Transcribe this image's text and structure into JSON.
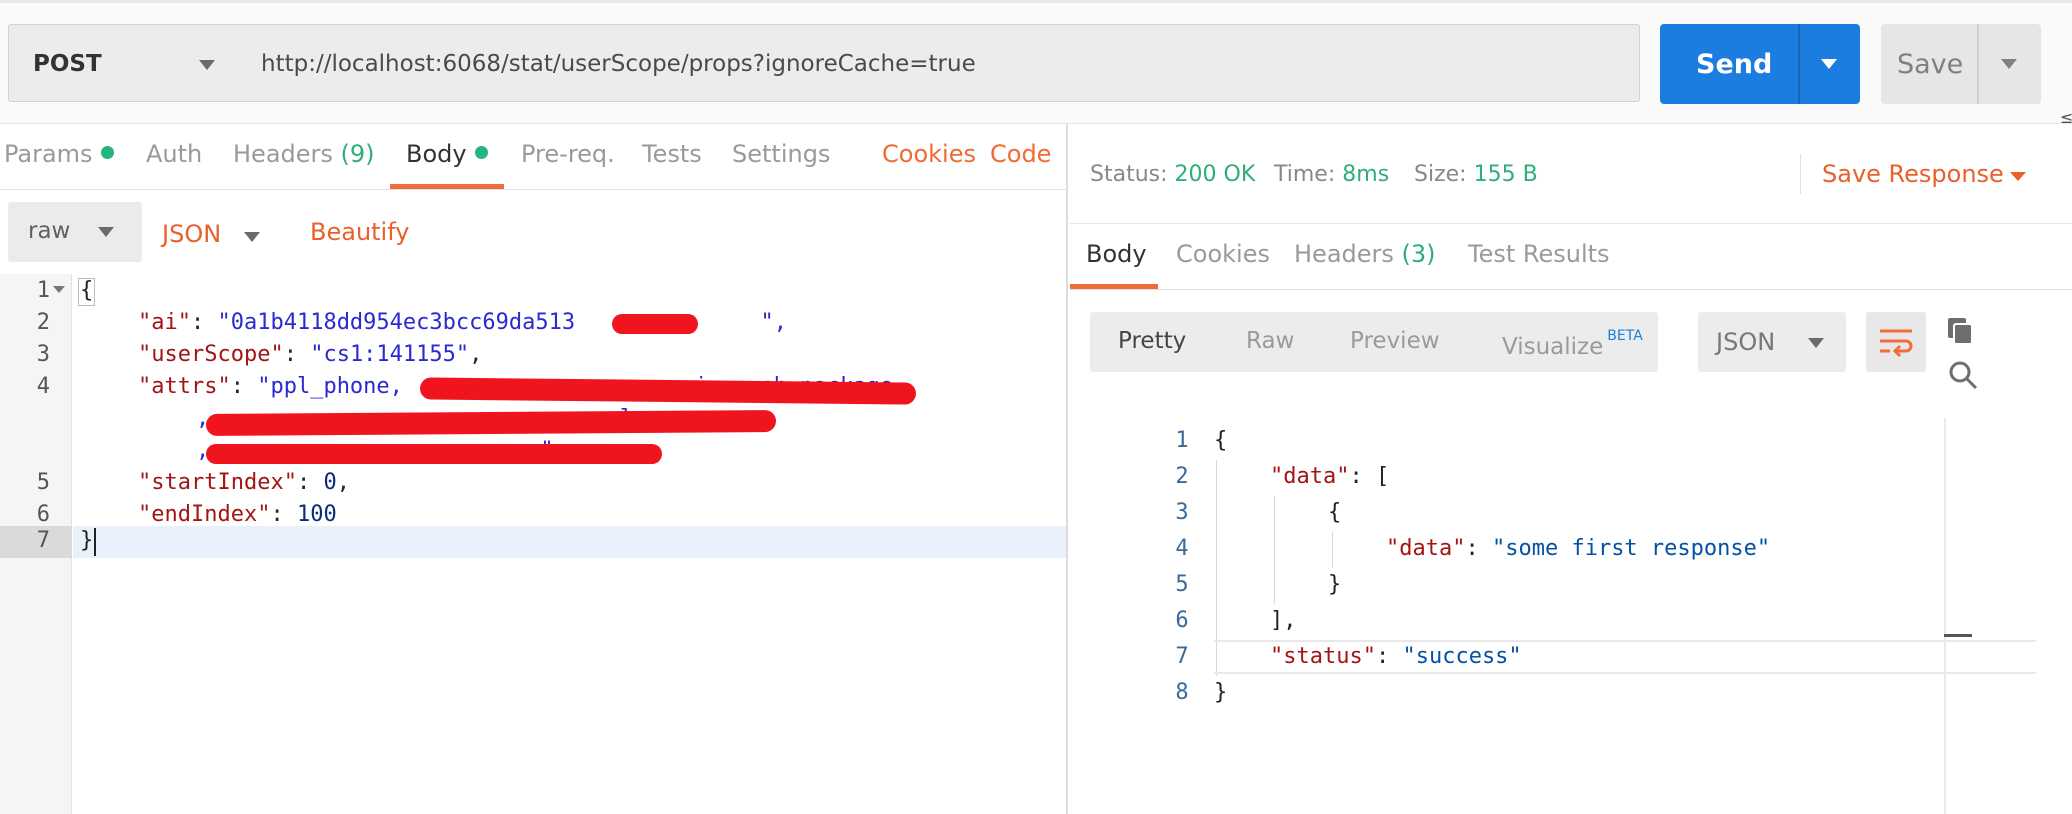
{
  "request": {
    "method": "POST",
    "url": "http://localhost:6068/stat/userScope/props?ignoreCache=true",
    "send_label": "Send",
    "save_label": "Save",
    "edge_glyph": "≤"
  },
  "req_tabs": {
    "params": "Params",
    "auth": "Auth",
    "headers": "Headers",
    "headers_count": "(9)",
    "body": "Body",
    "prereq": "Pre-req.",
    "tests": "Tests",
    "settings": "Settings",
    "cookies": "Cookies",
    "code": "Code"
  },
  "body_options": {
    "mode": "raw",
    "format": "JSON",
    "beautify": "Beautify"
  },
  "request_body": {
    "line_numbers": [
      "1",
      "2",
      "3",
      "4",
      "5",
      "6",
      "7"
    ],
    "l1": "{",
    "ai_key": "\"ai\"",
    "ai_val": "\"0a1b4118dd954ec3bcc69da513",
    "ai_tail": "\",",
    "scope_key": "\"userScope\"",
    "scope_val": "\"cs1:141155\"",
    "attrs_key": "\"attrs\"",
    "attrs_val": "\"ppl_phone,",
    "attrs_val2": "ic_push_package",
    "attrs_cont1": ",",
    "attrs_cont1_tail": "el",
    "attrs_cont2": ",",
    "attrs_cont2_tail": "\",",
    "start_key": "\"startIndex\"",
    "start_val": "0",
    "end_key": "\"endIndex\"",
    "end_val": "100",
    "l7": "}"
  },
  "response_meta": {
    "status_label": "Status:",
    "status_value": "200 OK",
    "time_label": "Time:",
    "time_value": "8ms",
    "size_label": "Size:",
    "size_value": "155 B",
    "save_response": "Save Response"
  },
  "res_tabs": {
    "body": "Body",
    "cookies": "Cookies",
    "headers": "Headers",
    "headers_count": "(3)",
    "test_results": "Test Results"
  },
  "view_modes": {
    "pretty": "Pretty",
    "raw": "Raw",
    "preview": "Preview",
    "visualize": "Visualize",
    "beta": "BETA",
    "format": "JSON"
  },
  "response_body": {
    "line_numbers": [
      "1",
      "2",
      "3",
      "4",
      "5",
      "6",
      "7",
      "8"
    ],
    "l1": "{",
    "data_key": "\"data\"",
    "l2_tail": ": [",
    "l3": "{",
    "inner_key": "\"data\"",
    "inner_val": "\"some first response\"",
    "l5": "}",
    "l6": "],",
    "status_key": "\"status\"",
    "status_val": "\"success\"",
    "l8": "}"
  },
  "colors": {
    "accent_orange": "#f26b3a",
    "send_blue": "#1c7de0",
    "success_green": "#2fae7a",
    "redaction_red": "#f0141e"
  }
}
